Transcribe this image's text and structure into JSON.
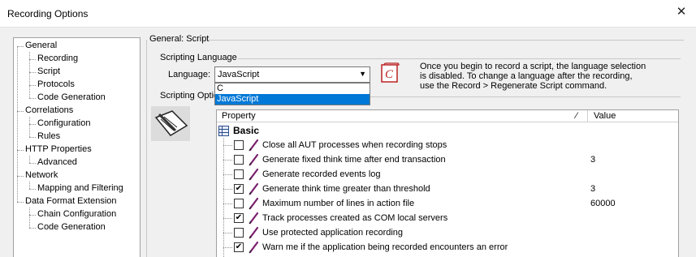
{
  "window": {
    "title": "Recording Options",
    "close_glyph": "✕"
  },
  "tree": {
    "items": [
      {
        "label": "General",
        "level": 0
      },
      {
        "label": "Recording",
        "level": 1
      },
      {
        "label": "Script",
        "level": 1
      },
      {
        "label": "Protocols",
        "level": 1
      },
      {
        "label": "Code Generation",
        "level": 1
      },
      {
        "label": "Correlations",
        "level": 0
      },
      {
        "label": "Configuration",
        "level": 1
      },
      {
        "label": "Rules",
        "level": 1
      },
      {
        "label": "HTTP Properties",
        "level": 0
      },
      {
        "label": "Advanced",
        "level": 1
      },
      {
        "label": "Network",
        "level": 0
      },
      {
        "label": "Mapping and Filtering",
        "level": 1
      },
      {
        "label": "Data Format Extension",
        "level": 0
      },
      {
        "label": "Chain Configuration",
        "level": 1
      },
      {
        "label": "Code Generation",
        "level": 1
      }
    ]
  },
  "panel": {
    "title": "General: Script",
    "scripting_language_group": "Scripting Language",
    "scripting_options_group": "Scripting Optio",
    "language_label": "Language:",
    "language_value": "JavaScript",
    "language_options": [
      "C",
      "JavaScript"
    ],
    "selected_option_index": 1,
    "info_line1": "Once you begin to record a script, the language selection",
    "info_line2": "is disabled. To change a language after the recording,",
    "info_line3": "use the Record > Regenerate Script command."
  },
  "grid": {
    "col_property": "Property",
    "col_value": "Value",
    "sort_glyph": "⁄",
    "group": "Basic",
    "rows": [
      {
        "label": "Close all AUT processes when recording stops",
        "checked": false,
        "value": ""
      },
      {
        "label": "Generate fixed think time after end transaction",
        "checked": false,
        "value": "3"
      },
      {
        "label": "Generate recorded events log",
        "checked": false,
        "value": ""
      },
      {
        "label": "Generate think time greater than threshold",
        "checked": true,
        "value": "3"
      },
      {
        "label": "Maximum number of lines in action file",
        "checked": false,
        "value": "60000"
      },
      {
        "label": "Track processes created as COM local servers",
        "checked": true,
        "value": ""
      },
      {
        "label": "Use protected application recording",
        "checked": false,
        "value": ""
      },
      {
        "label": "Warn me if the application being recorded encounters an error",
        "checked": true,
        "value": ""
      }
    ]
  },
  "colors": {
    "selection": "#0078d7",
    "pen": "#7a1f6e"
  }
}
